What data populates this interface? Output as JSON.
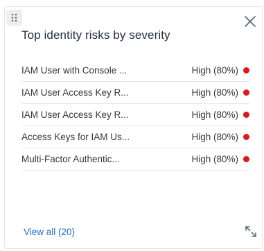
{
  "widget": {
    "title": "Top identity risks by severity",
    "view_all_label": "View all (20)",
    "severity_color": "#e0161b",
    "drag_icon": "drag-handle-icon",
    "close_icon": "close-icon",
    "expand_icon": "expand-icon"
  },
  "risks": [
    {
      "name": "IAM User with Console ...",
      "severity": "High (80%)"
    },
    {
      "name": "IAM User Access Key R...",
      "severity": "High (80%)"
    },
    {
      "name": "IAM User Access Key R...",
      "severity": "High (80%)"
    },
    {
      "name": "Access Keys for IAM Us...",
      "severity": "High (80%)"
    },
    {
      "name": "Multi-Factor Authentic...",
      "severity": "High (80%)"
    }
  ]
}
